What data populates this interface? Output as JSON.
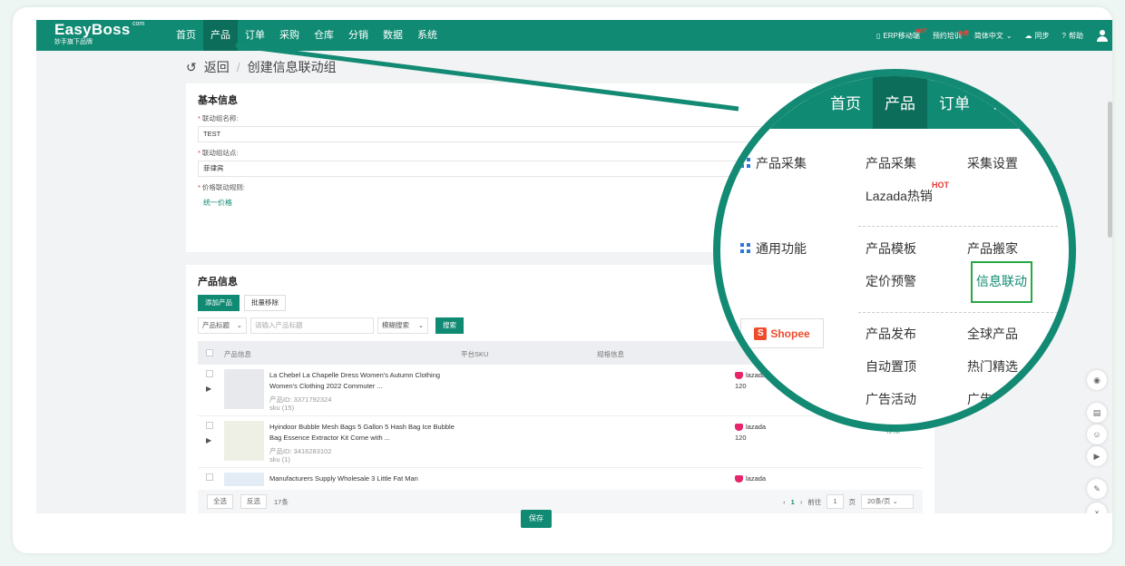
{
  "logo": {
    "name": "EasyBoss",
    "com": "com",
    "slogan": "妙手旗下品牌"
  },
  "nav": [
    "首页",
    "产品",
    "订单",
    "采购",
    "仓库",
    "分销",
    "数据",
    "系统"
  ],
  "nav_active": "产品",
  "topright": {
    "erp": "ERP移动端",
    "erp_badge": "HOT",
    "training": "预约培训",
    "training_badge": "免费",
    "lang": "简体中文",
    "sync": "同步",
    "help": "帮助"
  },
  "breadcrumb": {
    "back": "返回",
    "current": "创建信息联动组"
  },
  "basic": {
    "title": "基本信息",
    "name_label": "联动组名称:",
    "name_value": "TEST",
    "site_label": "联动组站点:",
    "site_value": "菲律宾",
    "rule_label": "价格联动规则:",
    "rule_value": "统一价格"
  },
  "products": {
    "title": "产品信息",
    "add_btn": "添加产品",
    "batch_remove_btn": "批量移除",
    "filter_field": "产品标题",
    "search_placeholder": "请输入产品标题",
    "match_mode": "模糊搜索",
    "search_btn": "搜索",
    "columns": {
      "info": "产品信息",
      "sku": "平台SKU",
      "spec": "规格信息"
    },
    "rows": [
      {
        "title": "La Chebel La Chapelle Dress Women's Autumn Clothing Women's Clothing 2022 Commuter ...",
        "pid": "产品ID: 3371792324",
        "sku": "sku (15)",
        "platform": "lazada",
        "price": "120",
        "action": ""
      },
      {
        "title": "Hyindoor Bubble Mesh Bags 5 Gallon 5 Hash Bag Ice Bubble Bag Essence Extractor Kit Come with ...",
        "pid": "产品ID: 3416283102",
        "sku": "sku (1)",
        "platform": "lazada",
        "price": "120",
        "action": "移除"
      },
      {
        "title": "Manufacturers Supply Wholesale 3 Little Fat Man",
        "pid": "",
        "sku": "",
        "platform": "lazada",
        "price": "",
        "action": ""
      }
    ],
    "footer": {
      "select_all": "全选",
      "invert": "反选",
      "count": "17条",
      "page": "1",
      "goto": "前往",
      "goto_page": "1",
      "page_unit": "页",
      "page_size": "20条/页"
    }
  },
  "save": "保存",
  "zoom": {
    "nav": [
      "首页",
      "产品",
      "订单",
      "采"
    ],
    "groups": {
      "collect": "产品采集",
      "common": "通用功能"
    },
    "items": {
      "collect": "产品采集",
      "collect_settings": "采集设置",
      "lazada_hot": "Lazada热销",
      "hot_badge": "HOT",
      "template": "产品模板",
      "move": "产品搬家",
      "price_alert": "定价预警",
      "info_link": "信息联动",
      "publish": "产品发布",
      "global": "全球产品",
      "auto_top": "自动置顶",
      "hot_pick": "热门精选",
      "ads": "广告活动",
      "ads2": "广告"
    },
    "shopee": "Shopee"
  },
  "colors": {
    "brand": "#108a73",
    "highlight": "#27a844",
    "danger": "#e53935"
  }
}
